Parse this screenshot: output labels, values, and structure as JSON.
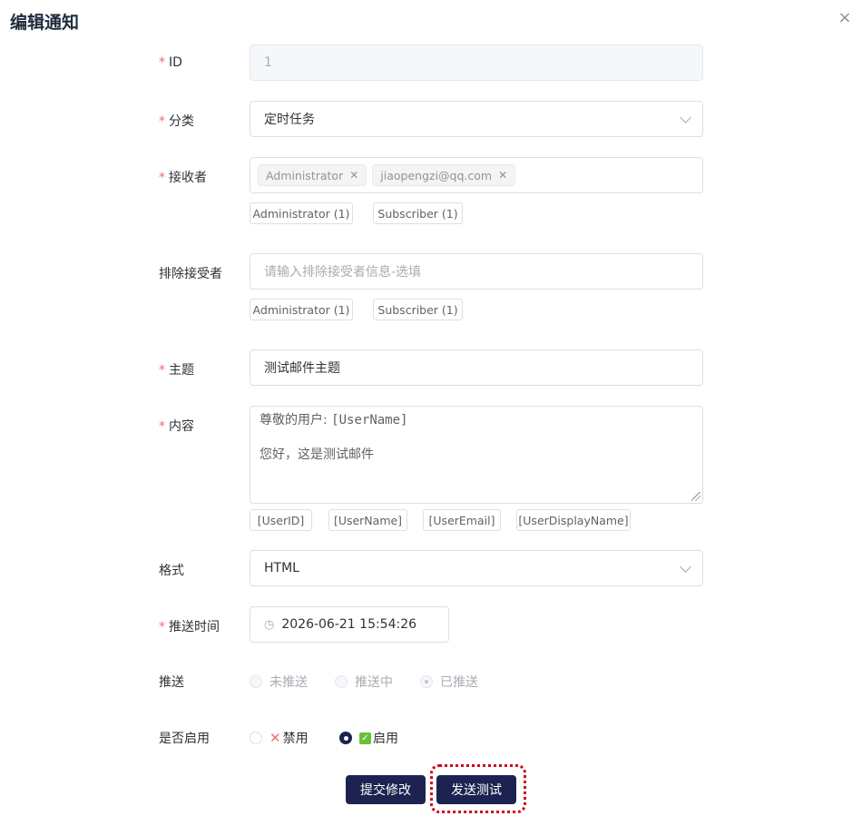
{
  "dialog": {
    "title": "编辑通知",
    "close_icon": "×"
  },
  "form": {
    "id": {
      "label": "ID",
      "value": "1"
    },
    "category": {
      "label": "分类",
      "value": "定时任务"
    },
    "recipients": {
      "label": "接收者",
      "tags": [
        "Administrator",
        "jiaopengzi@qq.com"
      ],
      "quick_chips": [
        "Administrator (1)",
        "Subscriber (1)"
      ]
    },
    "exclude": {
      "label": "排除接受者",
      "placeholder": "请输入排除接受者信息-选填",
      "quick_chips": [
        "Administrator (1)",
        "Subscriber (1)"
      ]
    },
    "subject": {
      "label": "主题",
      "value": "测试邮件主题"
    },
    "content": {
      "label": "内容",
      "line1_prefix": "尊敬的用户:",
      "line1_var": "[UserName]",
      "line2": "您好，这是测试邮件",
      "variables": [
        "[UserID]",
        "[UserName]",
        "[UserEmail]",
        "[UserDisplayName]"
      ]
    },
    "format": {
      "label": "格式",
      "value": "HTML"
    },
    "push_time": {
      "label": "推送时间",
      "value": "2026-06-21 15:54:26"
    },
    "push_status": {
      "label": "推送",
      "options": [
        "未推送",
        "推送中",
        "已推送"
      ],
      "selected": "已推送"
    },
    "enabled": {
      "label": "是否启用",
      "options": [
        "禁用",
        "启用"
      ],
      "selected": "启用"
    }
  },
  "buttons": {
    "submit": "提交修改",
    "send_test": "发送测试"
  },
  "colors": {
    "primary": "#1d2350",
    "required": "#f56c6c",
    "highlight": "#d0021b"
  }
}
